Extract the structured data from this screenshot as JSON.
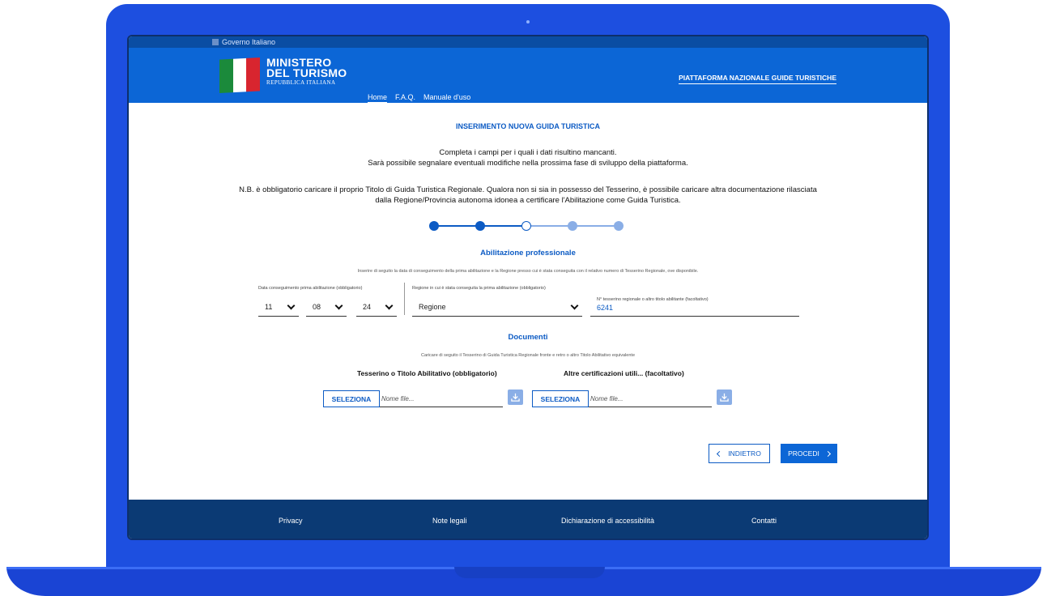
{
  "theme": {
    "primary": "#0c66d6",
    "dark": "#0b3a74",
    "laptop": "#1d4fe0"
  },
  "gov_bar": {
    "label": "Governo Italiano"
  },
  "logo": {
    "line1": "MINISTERO",
    "line2": "DEL TURISMO",
    "line3": "REPUBBLICA ITALIANA"
  },
  "nav": {
    "home": "Home",
    "faq": "F.A.Q.",
    "manual": "Manuale d'uso"
  },
  "platform_title": "PIATTAFORMA NAZIONALE GUIDE TURISTICHE",
  "page": {
    "title": "INSERIMENTO NUOVA GUIDA TURISTICA",
    "intro_line1": "Completa i campi per i quali i dati risultino mancanti.",
    "intro_line2": "Sarà possibile segnalare eventuali modifiche nella prossima fase di sviluppo della piattaforma.",
    "note_line1": "N.B. è obbligatorio caricare il proprio Titolo di Guida Turistica Regionale. Qualora non si sia in possesso del Tesserino, è possibile caricare altra documentazione rilasciata",
    "note_line2": "dalla Regione/Provincia autonoma idonea a certificare l'Abilitazione come Guida Turistica."
  },
  "stepper": {
    "total_steps": 5,
    "current_step": 3,
    "steps": [
      {
        "state": "completed"
      },
      {
        "state": "completed"
      },
      {
        "state": "current"
      },
      {
        "state": "upcoming"
      },
      {
        "state": "upcoming"
      }
    ]
  },
  "abilitazione": {
    "title": "Abilitazione professionale",
    "subtitle": "Inserire di seguito la data di conseguimento della prima abilitazione e la Regione presso cui è stata conseguita con il relativo numero di Tesserino Regionale, ove disponibile.",
    "date_label": "Data conseguimento prima abilitazione (obbligatorio)",
    "day": "11",
    "month": "08",
    "year": "24",
    "region_label": "Regione in cui è stata conseguita la prima abilitazione (obbligatorio)",
    "region_value": "Regione",
    "tesserino_label": "N° tesserino regionale o altro titolo abilitante (facoltativo)",
    "tesserino_value": "6241"
  },
  "documenti": {
    "title": "Documenti",
    "subtitle": "Caricare di seguito il Tesserino di Guida Turistica Regionale fronte e retro o altro Titolo Abilitativo equivalente",
    "upload1": {
      "label": "Tesserino o Titolo Abilitativo (obbligatorio)",
      "button": "SELEZIONA",
      "placeholder": "Nome file..."
    },
    "upload2": {
      "label": "Altre certificazioni utili... (facoltativo)",
      "button": "SELEZIONA",
      "placeholder": "Nome file..."
    }
  },
  "actions": {
    "back": "INDIETRO",
    "next": "PROCEDI"
  },
  "footer": {
    "privacy": "Privacy",
    "legal": "Note legali",
    "accessibility": "Dichiarazione di accessibilità",
    "contacts": "Contatti"
  }
}
